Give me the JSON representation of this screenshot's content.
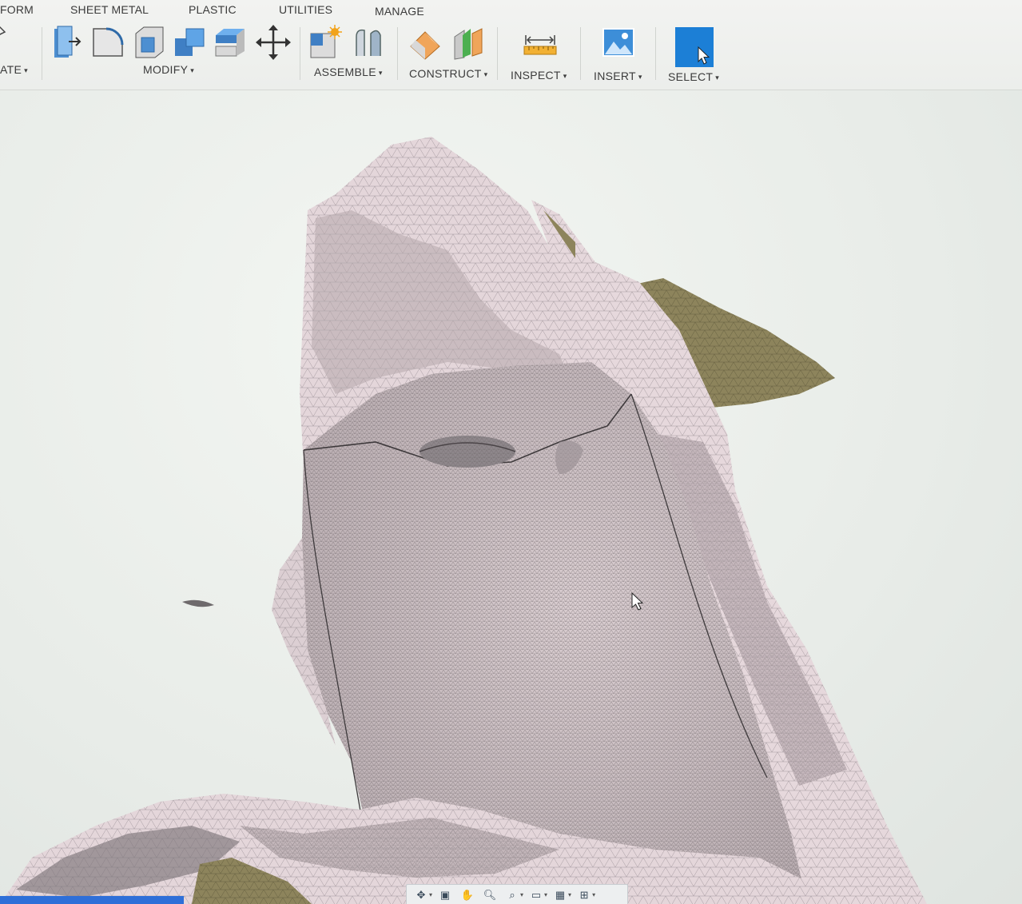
{
  "tabs": [
    "FORM",
    "SHEET METAL",
    "PLASTIC",
    "UTILITIES",
    "MANAGE"
  ],
  "groups": {
    "create": "ATE",
    "modify": "MODIFY",
    "assemble": "ASSEMBLE",
    "construct": "CONSTRUCT",
    "inspect": "INSPECT",
    "insert": "INSERT",
    "select": "SELECT"
  },
  "caret": "▾",
  "icons": {
    "modify": [
      "press-pull-icon",
      "fillet-icon",
      "shell-icon",
      "combine-icon",
      "replace-face-icon",
      "move-icon"
    ],
    "assemble": [
      "new-component-icon",
      "joint-icon"
    ],
    "construct": [
      "offset-plane-icon",
      "midplane-icon"
    ],
    "inspect": [
      "measure-icon"
    ],
    "insert": [
      "insert-image-icon"
    ],
    "select": [
      "select-cursor-icon"
    ]
  },
  "colors": {
    "mesh_face": "#e8d9dc",
    "mesh_line": "#7d7378",
    "backface": "#8c8460",
    "select_active": "#1c7fd6",
    "viewport_bg": "#eef1ed"
  },
  "navbar": {
    "items": [
      "orbit-icon",
      "look-at-icon",
      "pan-icon",
      "zoom-icon",
      "fit-icon",
      "display-settings-icon",
      "grid-icon",
      "viewports-icon"
    ]
  }
}
